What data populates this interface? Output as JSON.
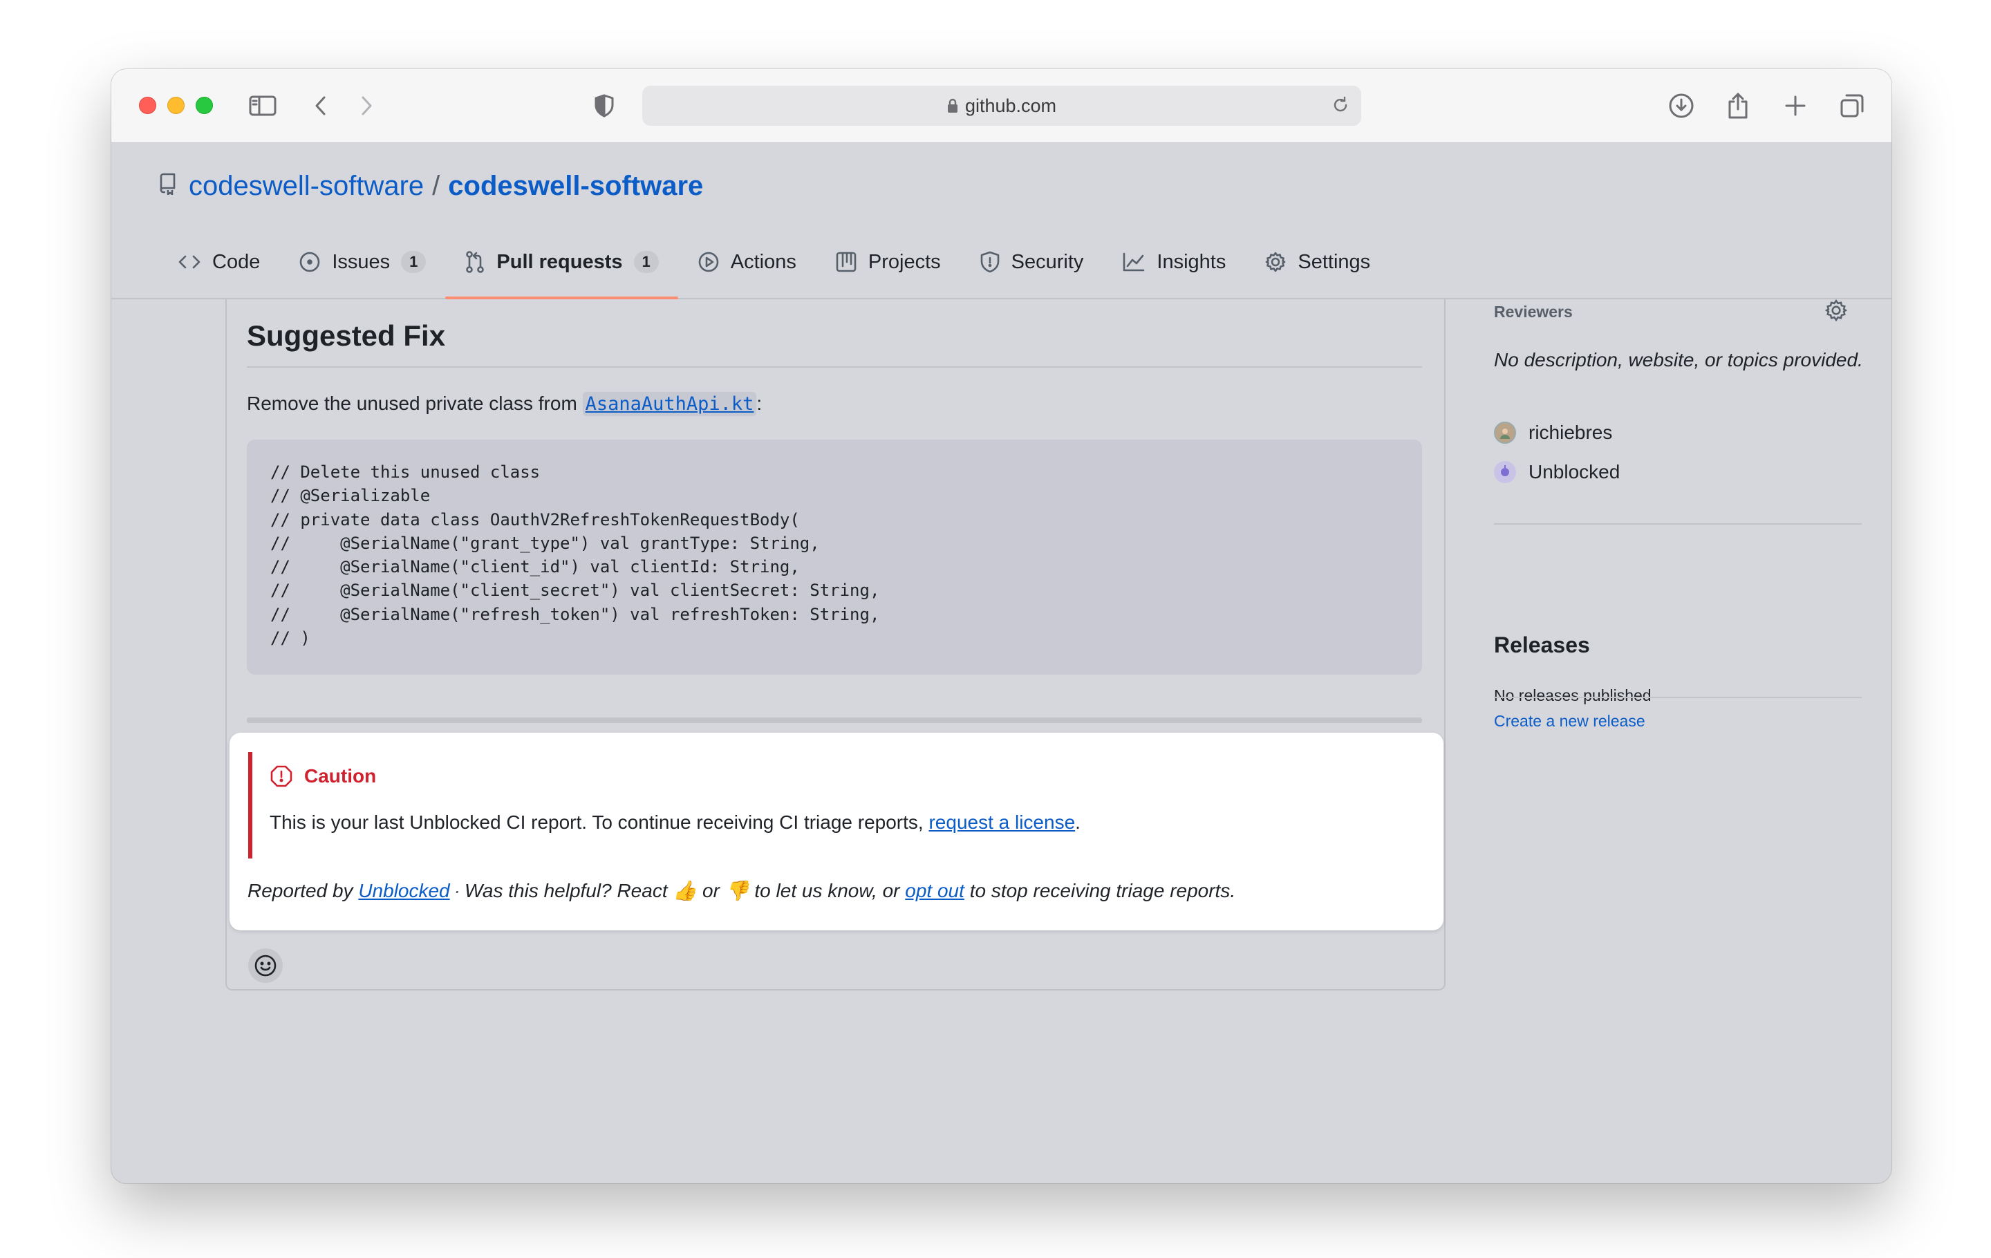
{
  "browser": {
    "url": "github.com"
  },
  "repo": {
    "owner": "codeswell-software",
    "separator": "/",
    "name": "codeswell-software"
  },
  "tabs": [
    {
      "label": "Code",
      "icon": "code-icon"
    },
    {
      "label": "Issues",
      "count": "1",
      "icon": "issue-opened-icon"
    },
    {
      "label": "Pull requests",
      "count": "1",
      "icon": "git-pull-request-icon",
      "active": true
    },
    {
      "label": "Actions",
      "icon": "play-icon"
    },
    {
      "label": "Projects",
      "icon": "table-icon"
    },
    {
      "label": "Security",
      "icon": "shield-icon"
    },
    {
      "label": "Insights",
      "icon": "graph-icon"
    },
    {
      "label": "Settings",
      "icon": "gear-icon"
    }
  ],
  "comment": {
    "heading": "Suggested Fix",
    "intro_prefix": "Remove the unused private class from ",
    "intro_file": "AsanaAuthApi.kt",
    "intro_suffix": ":",
    "code_lines": [
      "// Delete this unused class",
      "// @Serializable",
      "// private data class OauthV2RefreshTokenRequestBody(",
      "//     @SerialName(\"grant_type\") val grantType: String,",
      "//     @SerialName(\"client_id\") val clientId: String,",
      "//     @SerialName(\"client_secret\") val clientSecret: String,",
      "//     @SerialName(\"refresh_token\") val refreshToken: String,",
      "// )"
    ],
    "caution_title": "Caution",
    "caution_text_prefix": "This is your last Unblocked CI report. To continue receiving CI triage reports, ",
    "caution_link": "request a license",
    "caution_text_suffix": ".",
    "footer_prefix": "Reported by ",
    "footer_link_unblocked": "Unblocked",
    "footer_dot": "·",
    "footer_mid1": "Was this helpful? React ",
    "thumbs_up": "👍",
    "footer_or": " or ",
    "thumbs_down": "👎",
    "footer_mid2": " to let us know, or ",
    "footer_link_optout": "opt out",
    "footer_end": " to stop receiving triage reports."
  },
  "sidebar": {
    "reviewers_label": "Reviewers",
    "description": "No description, website, or topics provided.",
    "people": [
      "richiebres",
      "Unblocked"
    ],
    "releases_title": "Releases",
    "releases_none": "No releases published",
    "releases_link": "Create a new release"
  },
  "colors": {
    "accent_link": "#0b5cc7",
    "caution_red": "#cf222e",
    "active_tab_underline": "#fd8c73"
  }
}
